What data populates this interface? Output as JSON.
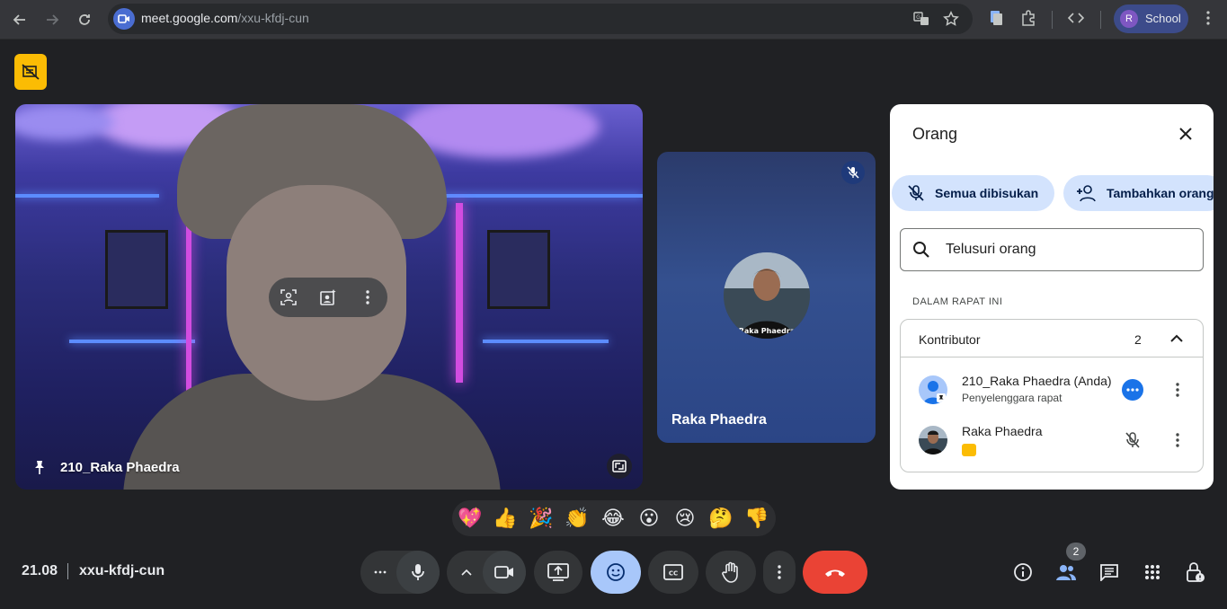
{
  "browser": {
    "url_host": "meet.google.com",
    "url_path": "/xxu-kfdj-cun",
    "profile_initial": "R",
    "profile_label": "School"
  },
  "main_tile": {
    "name": "210_Raka Phaedra"
  },
  "side_tile": {
    "name": "Raka Phaedra",
    "avatar_caption": "Raka Phaedra"
  },
  "people_panel": {
    "title": "Orang",
    "mute_all_label": "Semua dibisukan",
    "add_people_label": "Tambahkan orang",
    "search_placeholder": "Telusuri orang",
    "section_label": "DALAM RAPAT INI",
    "group": {
      "title": "Kontributor",
      "count": "2"
    },
    "participants": [
      {
        "name": "210_Raka Phaedra (Anda)",
        "subtitle": "Penyelenggara rapat"
      },
      {
        "name": "Raka Phaedra",
        "subtitle": ""
      }
    ]
  },
  "reactions": [
    "💖",
    "👍",
    "🎉",
    "👏",
    "😂",
    "😮",
    "😢",
    "🤔",
    "👎"
  ],
  "bottom_bar": {
    "time": "21.08",
    "meeting_code": "xxu-kfdj-cun",
    "participant_count": "2"
  },
  "colors": {
    "accent_blue": "#1a73e8",
    "end_call_red": "#ea4335",
    "active_reaction": "#a8c7fa",
    "recording_yellow": "#fbbc04"
  }
}
